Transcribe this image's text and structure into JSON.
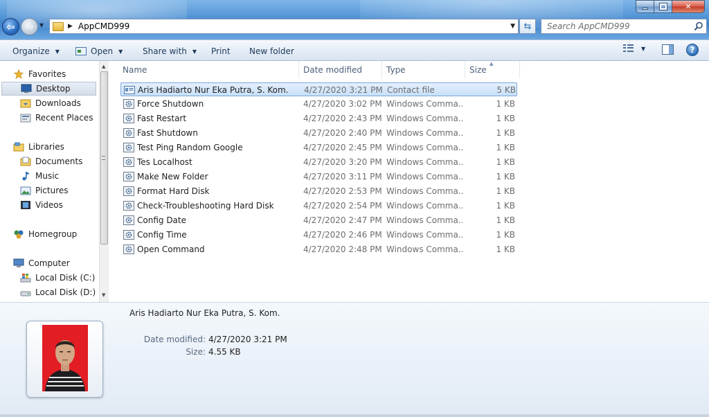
{
  "window": {
    "address": {
      "crumb": "AppCMD999"
    },
    "search": {
      "placeholder": "Search AppCMD999"
    }
  },
  "toolbar": {
    "organize": "Organize",
    "open": "Open",
    "share_with": "Share with",
    "print": "Print",
    "new_folder": "New folder"
  },
  "nav": {
    "favorites": "Favorites",
    "desktop": "Desktop",
    "downloads": "Downloads",
    "recent_places": "Recent Places",
    "libraries": "Libraries",
    "documents": "Documents",
    "music": "Music",
    "pictures": "Pictures",
    "videos": "Videos",
    "homegroup": "Homegroup",
    "computer": "Computer",
    "local_c": "Local Disk (C:)",
    "local_d": "Local Disk (D:)"
  },
  "columns": {
    "name": "Name",
    "date_modified": "Date modified",
    "type": "Type",
    "size": "Size"
  },
  "files": [
    {
      "name": "Aris Hadiarto Nur Eka Putra, S. Kom.",
      "date": "4/27/2020 3:21 PM",
      "type": "Contact file",
      "size": "5 KB"
    },
    {
      "name": "Force Shutdown",
      "date": "4/27/2020 3:02 PM",
      "type": "Windows Comma...",
      "size": "1 KB"
    },
    {
      "name": "Fast Restart",
      "date": "4/27/2020 2:43 PM",
      "type": "Windows Comma...",
      "size": "1 KB"
    },
    {
      "name": "Fast Shutdown",
      "date": "4/27/2020 2:40 PM",
      "type": "Windows Comma...",
      "size": "1 KB"
    },
    {
      "name": "Test Ping Random Google",
      "date": "4/27/2020 2:45 PM",
      "type": "Windows Comma...",
      "size": "1 KB"
    },
    {
      "name": "Tes Localhost",
      "date": "4/27/2020 3:20 PM",
      "type": "Windows Comma...",
      "size": "1 KB"
    },
    {
      "name": "Make New Folder",
      "date": "4/27/2020 3:11 PM",
      "type": "Windows Comma...",
      "size": "1 KB"
    },
    {
      "name": "Format Hard Disk",
      "date": "4/27/2020 2:53 PM",
      "type": "Windows Comma...",
      "size": "1 KB"
    },
    {
      "name": "Check-Troubleshooting Hard Disk",
      "date": "4/27/2020 2:54 PM",
      "type": "Windows Comma...",
      "size": "1 KB"
    },
    {
      "name": "Config Date",
      "date": "4/27/2020 2:47 PM",
      "type": "Windows Comma...",
      "size": "1 KB"
    },
    {
      "name": "Config Time",
      "date": "4/27/2020 2:46 PM",
      "type": "Windows Comma...",
      "size": "1 KB"
    },
    {
      "name": "Open Command",
      "date": "4/27/2020 2:48 PM",
      "type": "Windows Comma...",
      "size": "1 KB"
    }
  ],
  "details": {
    "title": "Aris Hadiarto Nur Eka Putra, S. Kom.",
    "date_modified_label": "Date modified:",
    "date_modified_value": "4/27/2020 3:21 PM",
    "size_label": "Size:",
    "size_value": "4.55 KB"
  },
  "colors": {
    "selection": "#cce4f7",
    "accent": "#1e395b",
    "photo_background": "#e21d24"
  },
  "icons": {
    "contact_file": "contact-card-icon",
    "command_file": "batch-gear-icon"
  }
}
